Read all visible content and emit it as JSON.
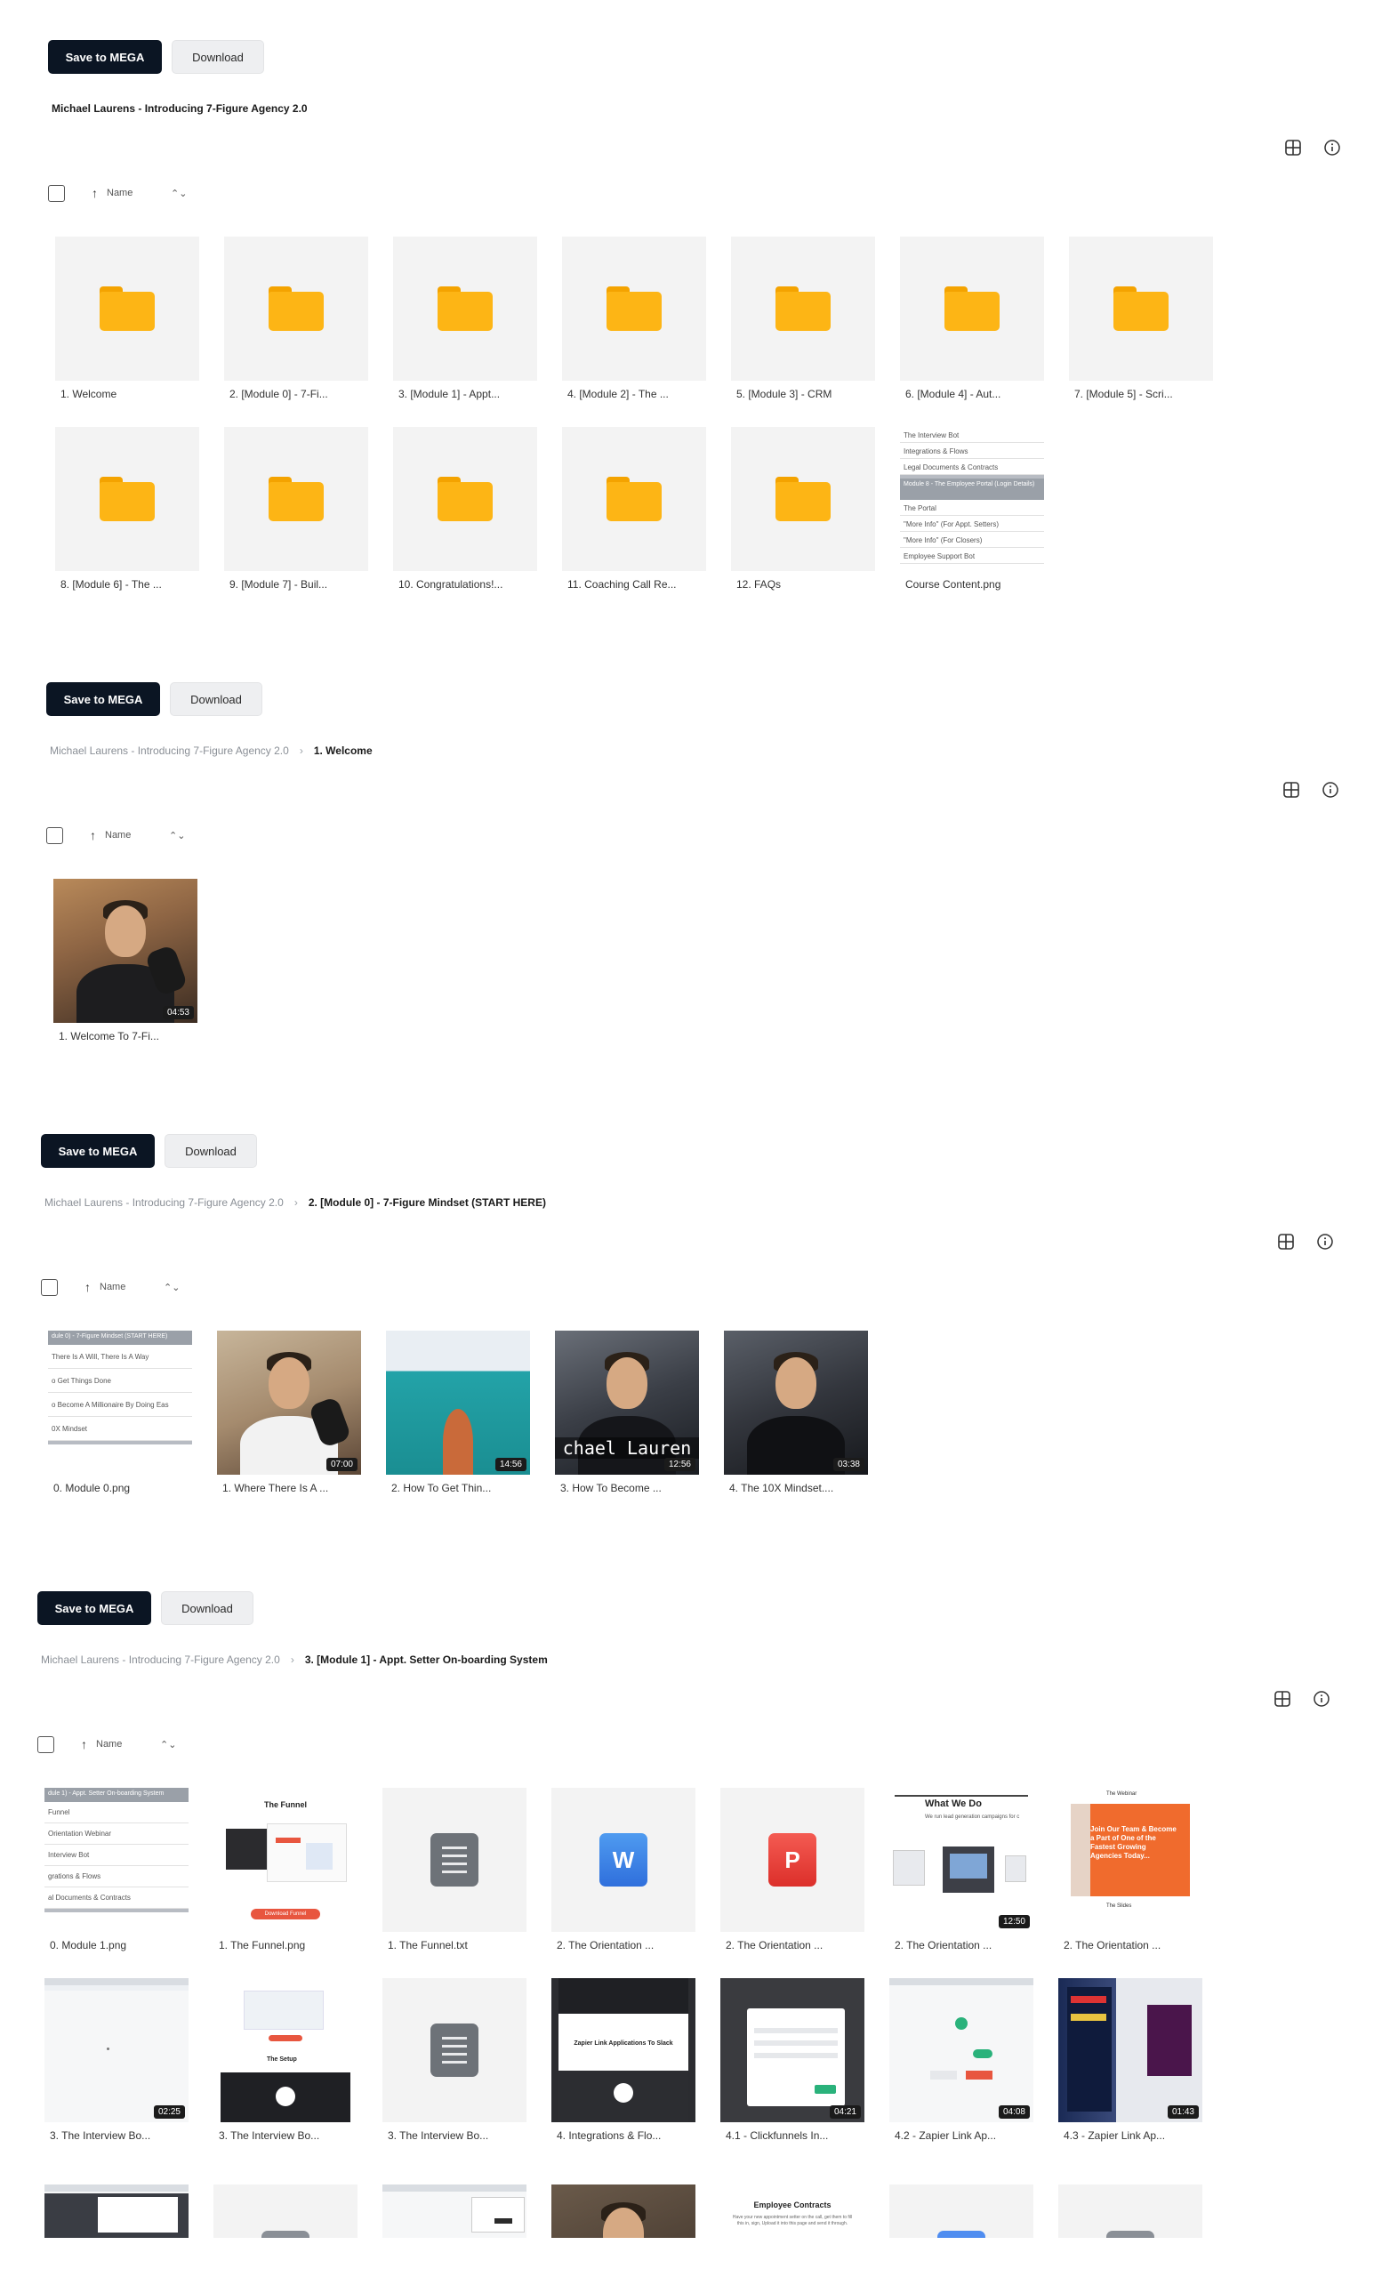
{
  "actions": {
    "save_label": "Save to MEGA",
    "download_label": "Download"
  },
  "sort": {
    "label": "Name"
  },
  "root_title": "Michael Laurens - Introducing 7-Figure Agency 2.0",
  "sections": [
    {
      "breadcrumb_current": "",
      "items": [
        {
          "label": "1. Welcome"
        },
        {
          "label": "2. [Module 0] - 7-Fi..."
        },
        {
          "label": "3. [Module 1] - Appt..."
        },
        {
          "label": "4. [Module 2] - The ..."
        },
        {
          "label": "5. [Module 3] - CRM"
        },
        {
          "label": "6. [Module 4] - Aut..."
        },
        {
          "label": "7. [Module 5] - Scri..."
        },
        {
          "label": "8. [Module 6] - The ..."
        },
        {
          "label": "9. [Module 7] - Buil..."
        },
        {
          "label": "10. Congratulations!..."
        },
        {
          "label": "11. Coaching Call Re..."
        },
        {
          "label": "12. FAQs"
        },
        {
          "label": "Course Content.png"
        }
      ],
      "course_content_rows": [
        "The Interview Bot",
        "Integrations & Flows",
        "Legal Documents & Contracts",
        "Module 8 - The Employee Portal (Login Details)",
        "The Portal",
        "\"More Info\" (For Appt. Setters)",
        "\"More Info\" (For Closers)",
        "Employee Support Bot"
      ]
    },
    {
      "breadcrumb_current": "1. Welcome",
      "items": [
        {
          "label": "1. Welcome To 7-Fi...",
          "duration": "04:53"
        }
      ]
    },
    {
      "breadcrumb_current": "2. [Module 0] - 7-Figure Mindset (START HERE)",
      "items": [
        {
          "label": "0. Module 0.png"
        },
        {
          "label": "1. Where There Is A ...",
          "duration": "07:00"
        },
        {
          "label": "2. How To Get Thin...",
          "duration": "14:56"
        },
        {
          "label": "3. How To Become ...",
          "duration": "12:56"
        },
        {
          "label": "4. The 10X Mindset....",
          "duration": "03:38"
        }
      ],
      "module0_rows": [
        "dule 0) - 7-Figure Mindset (START HERE)",
        "There Is A Will, There Is A Way",
        "o Get Things Done",
        "o Become A Millionaire By Doing Eas",
        "0X Mindset"
      ],
      "caption_overlay": "chael Lauren"
    },
    {
      "breadcrumb_current": "3. [Module 1] - Appt. Setter On-boarding System",
      "items": [
        {
          "label": "0. Module 1.png"
        },
        {
          "label": "1. The Funnel.png"
        },
        {
          "label": "1. The Funnel.txt"
        },
        {
          "label": "2. The Orientation ..."
        },
        {
          "label": "2. The Orientation ..."
        },
        {
          "label": "2. The Orientation ...",
          "duration": "12:50"
        },
        {
          "label": "2. The Orientation ..."
        },
        {
          "label": "3. The Interview Bo...",
          "duration": "02:25"
        },
        {
          "label": "3. The Interview Bo..."
        },
        {
          "label": "3. The Interview Bo..."
        },
        {
          "label": "4. Integrations & Flo..."
        },
        {
          "label": "4.1 - Clickfunnels In...",
          "duration": "04:21"
        },
        {
          "label": "4.2 - Zapier Link Ap...",
          "duration": "04:08"
        },
        {
          "label": "4.3 - Zapier Link Ap...",
          "duration": "01:43"
        }
      ],
      "module1_rows": [
        "dule 1) - Appt. Setter On-boarding System",
        "Funnel",
        "Orientation Webinar",
        "Interview Bot",
        "grations & Flows",
        "al Documents & Contracts"
      ],
      "funnel_title": "The Funnel",
      "funnel_button": "Download Funnel",
      "what_we_do": "What We Do",
      "what_we_do_sub": "We run lead generation campaigns for c",
      "webinar_title": "The Webinar",
      "webinar_promo": "Join Our Team & Become a Part of One of the Fastest Growing Agencies Today...",
      "webinar_slides": "The Slides",
      "setup_title": "The Setup",
      "zapier_title": "Zapier Link Applications To Slack",
      "employee_contracts": "Employee Contracts",
      "employee_contracts_sub": "Have your new appointment setter on the call, get them to fill this in, sign, Upload it into this page and send it through."
    }
  ]
}
